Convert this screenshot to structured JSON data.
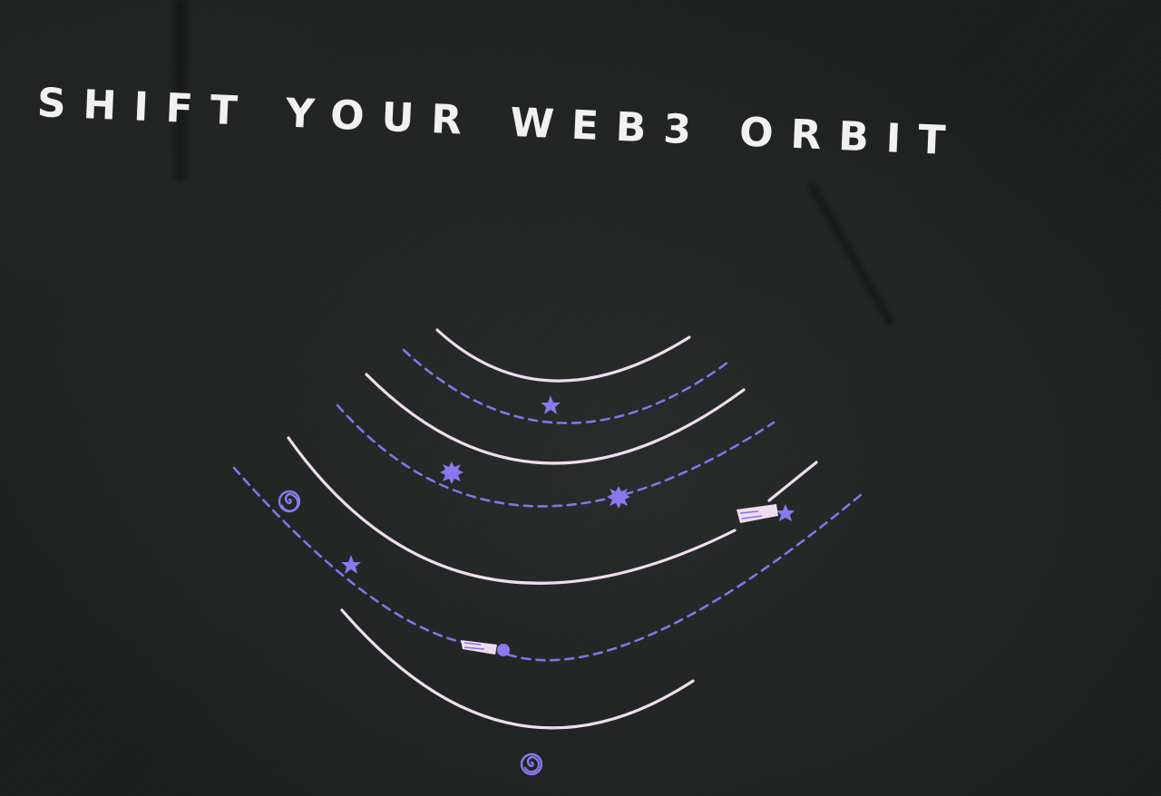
{
  "print": {
    "headline": "SHIFT YOUR WEB3 ORBIT"
  },
  "colors": {
    "fabric": "#1c1f1e",
    "headline": "#f1f1f1",
    "orbit_solid": "#f0dcef",
    "orbit_dashed": "#8474e8",
    "accent": "#8a78ec"
  },
  "graphic": {
    "solid_orbits": 5,
    "dashed_orbits": 4,
    "icons": [
      "star-icon",
      "burst-icon",
      "spiral-icon",
      "comet-icon"
    ]
  }
}
